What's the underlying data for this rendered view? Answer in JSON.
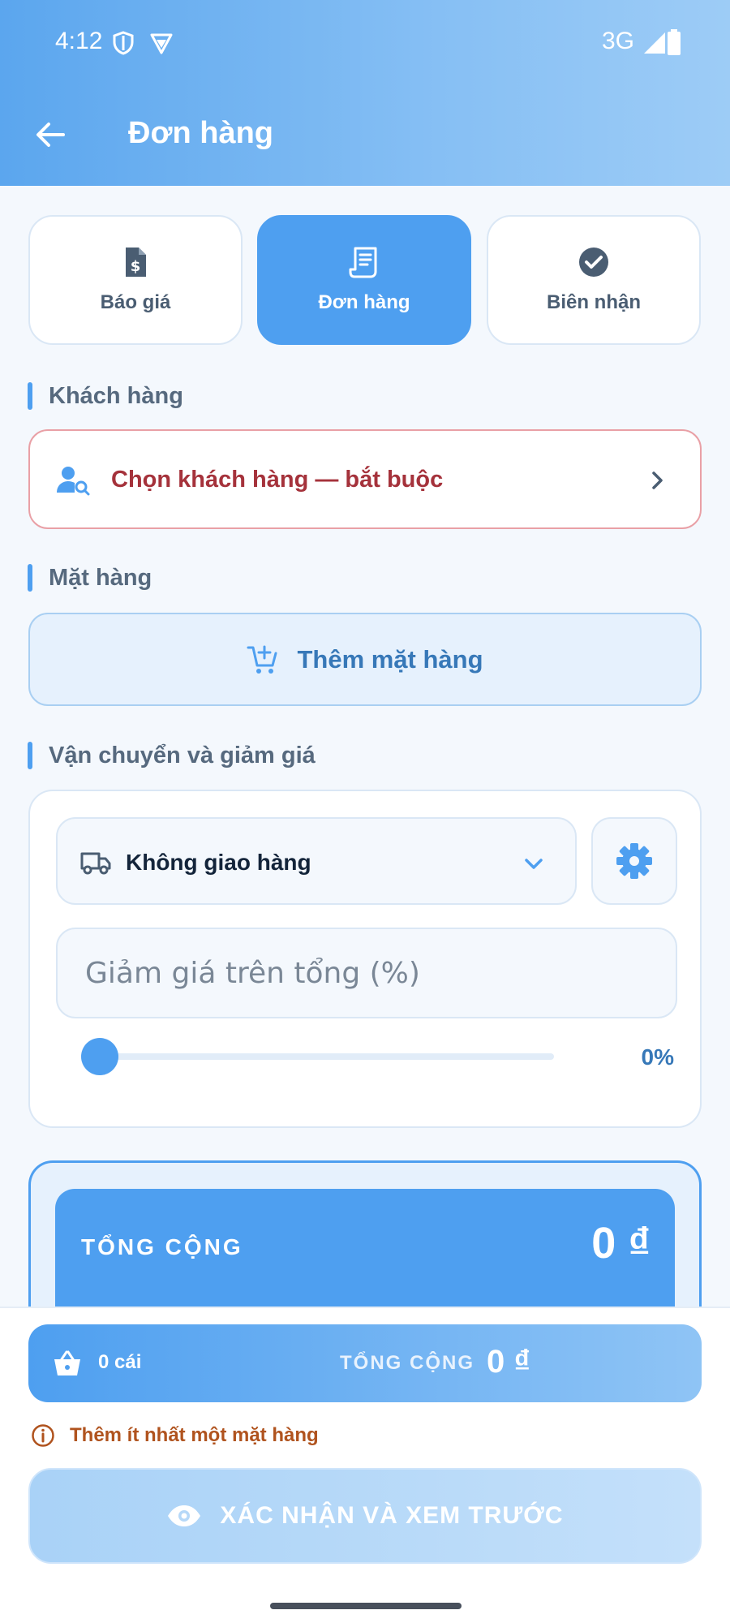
{
  "status_bar": {
    "time": "4:12",
    "network": "3G"
  },
  "app_bar": {
    "title": "Đơn hàng"
  },
  "segments": [
    {
      "label": "Báo giá",
      "icon": "dollar-document-icon",
      "active": false
    },
    {
      "label": "Đơn hàng",
      "icon": "receipt-icon",
      "active": true
    },
    {
      "label": "Biên nhận",
      "icon": "check-circle-icon",
      "active": false
    }
  ],
  "customer_section": {
    "heading": "Khách hàng",
    "select_label": "Chọn khách hàng — bắt buộc"
  },
  "items_section": {
    "heading": "Mặt hàng",
    "add_label": "Thêm mặt hàng"
  },
  "shipping_section": {
    "heading": "Vận chuyển và giảm giá",
    "shipping_option": "Không giao hàng",
    "discount_placeholder": "Giảm giá trên tổng (%)",
    "discount_value_label": "0%",
    "discount_percent": 0
  },
  "total_card": {
    "label": "TỔNG CỘNG",
    "value": "0 ₫"
  },
  "summary_bar": {
    "count": "0 cái",
    "label": "TỔNG CỘNG",
    "value": "0 ₫"
  },
  "warning": "Thêm ít nhất một mặt hàng",
  "confirm_button": "XÁC NHẬN VÀ XEM TRƯỚC",
  "colors": {
    "primary": "#4e9ff0",
    "danger": "#a5323b",
    "warning": "#b0531e"
  }
}
